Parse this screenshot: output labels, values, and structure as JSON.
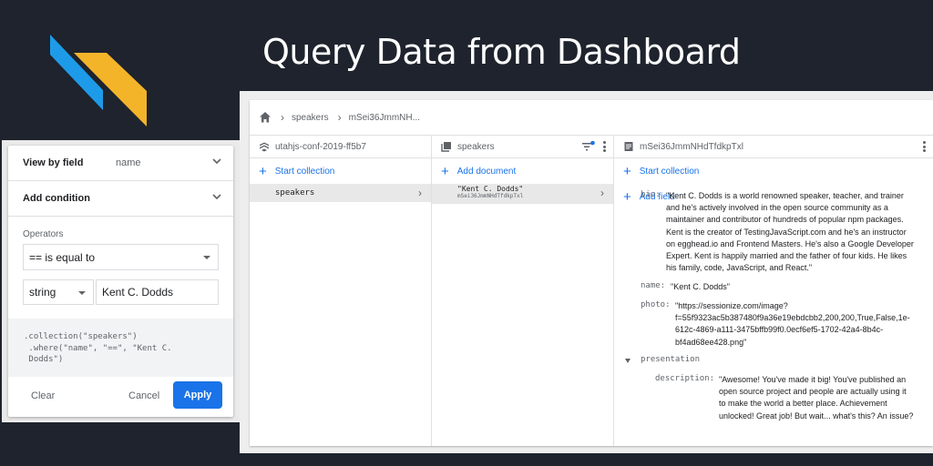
{
  "page": {
    "title": "Query Data from Dashboard"
  },
  "colors": {
    "accent": "#1a73e8",
    "logo_blue": "#1e9be8",
    "logo_yellow": "#f4b42a",
    "background": "#1e232d"
  },
  "breadcrumb": {
    "items": [
      "speakers",
      "mSei36JmmNH..."
    ]
  },
  "columns": {
    "project": {
      "title": "utahjs-conf-2019-ff5b7",
      "add_label": "Start collection",
      "items": [
        "speakers"
      ]
    },
    "collection": {
      "title": "speakers",
      "add_label": "Add document",
      "doc": {
        "name": "\"Kent C. Dodds\"",
        "id": "mSei36JmmNHdTfdkpTxl"
      }
    },
    "document": {
      "title": "mSei36JmmNHdTfdkpTxl",
      "add_collection": "Start collection",
      "add_field": "Add field",
      "fields": {
        "bio_key": "bio:",
        "bio_lines": [
          "\"Kent C. Dodds is a world renowned speaker, teacher, and trainer",
          "and he's actively involved in the open source community as a",
          "maintainer and contributor of hundreds of popular npm packages.",
          "Kent is the creator of TestingJavaScript.com and he's an instructor",
          "on egghead.io and Frontend Masters. He's also a Google Developer",
          "Expert. Kent is happily married and the father of four kids. He likes",
          "his family, code, JavaScript, and React.\""
        ],
        "name_key": "name:",
        "name_val": "\"Kent C. Dodds\"",
        "photo_key": "photo:",
        "photo_lines": [
          "\"https://sessionize.com/image?",
          "f=55f9323ac5b387480f9a36e19ebdcbb2,200,200,True,False,1e-",
          "612c-4869-a111-3475bffb99f0.0ecf6ef5-1702-42a4-8b4c-",
          "bf4ad68ee428.png\""
        ],
        "presentation_key": "presentation",
        "description_key": "description:",
        "description_lines": [
          "\"Awesome! You've made it big! You've published an",
          "open source project and people are actually using it",
          "to make the world a better place. Achievement",
          "unlocked! Great job! But wait... what's this? An issue?"
        ]
      }
    }
  },
  "query_panel": {
    "view_by_label": "View by field",
    "view_by_value": "name",
    "add_condition_label": "Add condition",
    "operators_label": "Operators",
    "operator_value": "== is equal to",
    "type_value": "string",
    "value_input": "Kent C. Dodds",
    "code_lines": [
      ".collection(\"speakers\")",
      " .where(\"name\", \"==\", \"Kent C.",
      " Dodds\")"
    ],
    "clear_label": "Clear",
    "cancel_label": "Cancel",
    "apply_label": "Apply"
  }
}
